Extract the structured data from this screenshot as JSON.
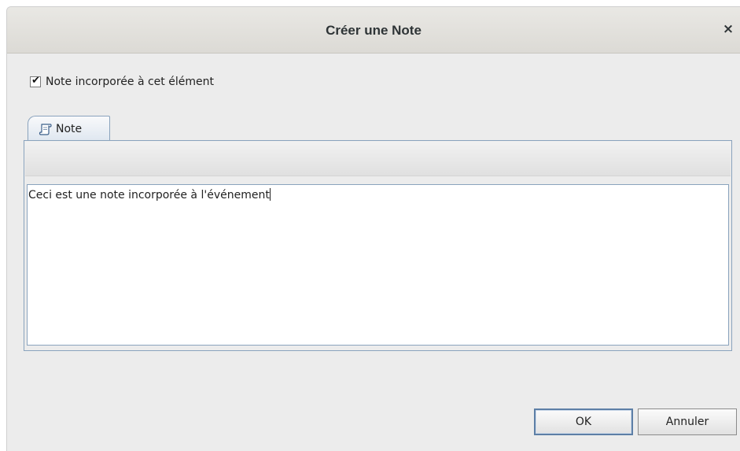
{
  "dialog": {
    "title": "Créer une Note",
    "close_glyph": "×"
  },
  "checkbox": {
    "label": "Note incorporée à cet élément",
    "checked": true,
    "check_glyph": "✔"
  },
  "tab": {
    "label": "Note",
    "icon": "note-scroll-icon"
  },
  "editor": {
    "text": "Ceci est une note incorporée à l'événement"
  },
  "buttons": {
    "ok_label": "OK",
    "cancel_label": "Annuler"
  },
  "colors": {
    "window_bg": "#ececec",
    "accent_border": "#8aa3bd",
    "ok_border": "#5d7fa6"
  }
}
